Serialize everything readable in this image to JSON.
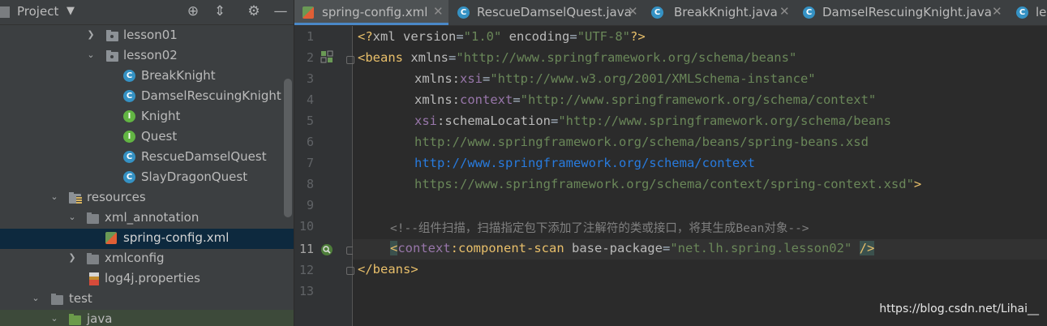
{
  "project_panel": {
    "title": "Project",
    "icons": [
      "crosshair-icon",
      "collapse-icon",
      "gear-icon",
      "minimize-icon"
    ],
    "tree": [
      {
        "label": "lesson01",
        "icon": "package-folder",
        "expanded": false
      },
      {
        "label": "lesson02",
        "icon": "package-folder",
        "expanded": true
      },
      {
        "label": "BreakKnight",
        "icon": "class",
        "badge": "C"
      },
      {
        "label": "DamselRescuingKnight",
        "icon": "class",
        "badge": "C"
      },
      {
        "label": "Knight",
        "icon": "interface",
        "badge": "I"
      },
      {
        "label": "Quest",
        "icon": "interface",
        "badge": "I"
      },
      {
        "label": "RescueDamselQuest",
        "icon": "class",
        "badge": "C"
      },
      {
        "label": "SlayDragonQuest",
        "icon": "class",
        "badge": "C"
      },
      {
        "label": "resources",
        "icon": "resources-folder",
        "expanded": true
      },
      {
        "label": "xml_annotation",
        "icon": "folder",
        "expanded": true
      },
      {
        "label": "spring-config.xml",
        "icon": "xml-file",
        "selected": true
      },
      {
        "label": "xmlconfig",
        "icon": "folder",
        "expanded": false
      },
      {
        "label": "log4j.properties",
        "icon": "properties-file"
      },
      {
        "label": "test",
        "icon": "folder",
        "expanded": true
      },
      {
        "label": "java",
        "icon": "test-source-folder",
        "expanded": true
      }
    ]
  },
  "editor": {
    "tabs": [
      {
        "label": "spring-config.xml",
        "icon": "xml-file",
        "active": true
      },
      {
        "label": "RescueDamselQuest.java",
        "icon": "class"
      },
      {
        "label": "BreakKnight.java",
        "icon": "class"
      },
      {
        "label": "DamselRescuingKnight.java",
        "icon": "class"
      },
      {
        "label": "le",
        "icon": "class"
      }
    ],
    "line_numbers": [
      "1",
      "2",
      "3",
      "4",
      "5",
      "6",
      "7",
      "8",
      "9",
      "10",
      "11",
      "12",
      "13"
    ],
    "current_line": "11",
    "code": {
      "l1": {
        "a": "<?",
        "b": "xml ",
        "c": "version",
        "d": "=",
        "e": "\"1.0\"",
        "f": " encoding",
        "g": "=",
        "h": "\"UTF-8\"",
        "i": "?>"
      },
      "l2": {
        "a": "<beans",
        "b": " xmlns",
        "c": "=",
        "d": "\"http://www.springframework.org/schema/beans\""
      },
      "l3": {
        "a": "xmlns:",
        "b": "xsi",
        "c": "=",
        "d": "\"http://www.w3.org/2001/XMLSchema-instance\""
      },
      "l4": {
        "a": "xmlns:",
        "b": "context",
        "c": "=",
        "d": "\"http://www.springframework.org/schema/context\""
      },
      "l5": {
        "a": "xsi",
        "b": ":schemaLocation",
        "c": "=",
        "d": "\"http://www.springframework.org/schema/beans"
      },
      "l6": {
        "a": "http://www.springframework.org/schema/beans/spring-beans.xsd"
      },
      "l7": {
        "a": "http://www.springframework.org/schema/context"
      },
      "l8": {
        "a": "https://www.springframework.org/schema/context/spring-context.xsd\"",
        "b": ">"
      },
      "l10": {
        "a": "<!--组件扫描，扫描指定包下添加了注解符的类或接口，将其生成Bean对象-->"
      },
      "l11": {
        "a": "<",
        "b": "context",
        "c": ":component-scan",
        "d": " base-package",
        "e": "=",
        "f": "\"net.lh.spring.lesson02\"",
        "g": " ",
        "h": "/>"
      },
      "l12": {
        "a": "</beans>"
      }
    }
  },
  "watermark": "https://blog.csdn.net/Lihai__"
}
